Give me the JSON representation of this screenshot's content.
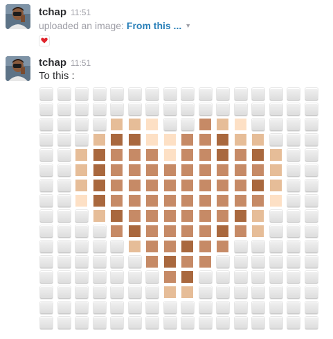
{
  "messages": [
    {
      "username": "tchap",
      "time": "11:51",
      "action_text": "uploaded an image:",
      "file_link": "From this ...",
      "reaction": "heart"
    },
    {
      "username": "tchap",
      "time": "11:51",
      "text": "To this :"
    }
  ],
  "emoji_grid": {
    "columns": 16,
    "rows": 16,
    "palette": {
      "0": "empty",
      "1": "#fde0c5",
      "2": "#e6bd98",
      "3": "#c68a66",
      "4": "#a9683e"
    },
    "cells": [
      "0000000000000000",
      "0000000000000000",
      "0000221003210000",
      "0002441133422000",
      "0024333133434200",
      "0024333333333200",
      "0024333333334200",
      "0014333333333100",
      "0002433333342000",
      "0000343333432000",
      "0000023343300000",
      "0000003433000000",
      "0000000340000000",
      "0000000220000000",
      "0000000000000000",
      "0000000000000000"
    ]
  }
}
